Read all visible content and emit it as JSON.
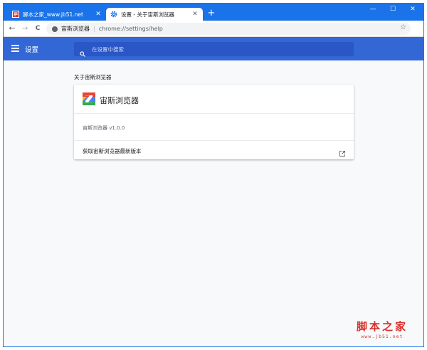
{
  "browser": {
    "tabs": [
      {
        "title": "脚本之家_www.jb51.net",
        "icon": "jb51-favicon",
        "active": false
      },
      {
        "title": "设置 - 关于宙斯浏览器",
        "icon": "gear-icon",
        "active": true
      }
    ],
    "new_tab": "+",
    "window_controls": {
      "minimize": "—",
      "maximize": "☐",
      "close": "✕"
    },
    "nav": {
      "back": "←",
      "forward": "→",
      "reload": "C"
    },
    "omnibox": {
      "site": "宙斯浏览器",
      "url": "chrome://settings/help",
      "bookmark": "☆"
    }
  },
  "settings": {
    "title": "设置",
    "search_placeholder": "在设置中搜索",
    "section_title": "关于宙斯浏览器",
    "product_name": "宙斯浏览器",
    "version": "宙斯浏览器 v1.0.0",
    "update_label": "获取宙斯浏览器最新版本"
  },
  "watermark": {
    "main": "脚本之家",
    "sub": "www.jb51.net"
  },
  "colors": {
    "accent": "#1a73e8",
    "header": "#3367d6",
    "search": "#2a56c6",
    "watermark": "#d9302c"
  }
}
